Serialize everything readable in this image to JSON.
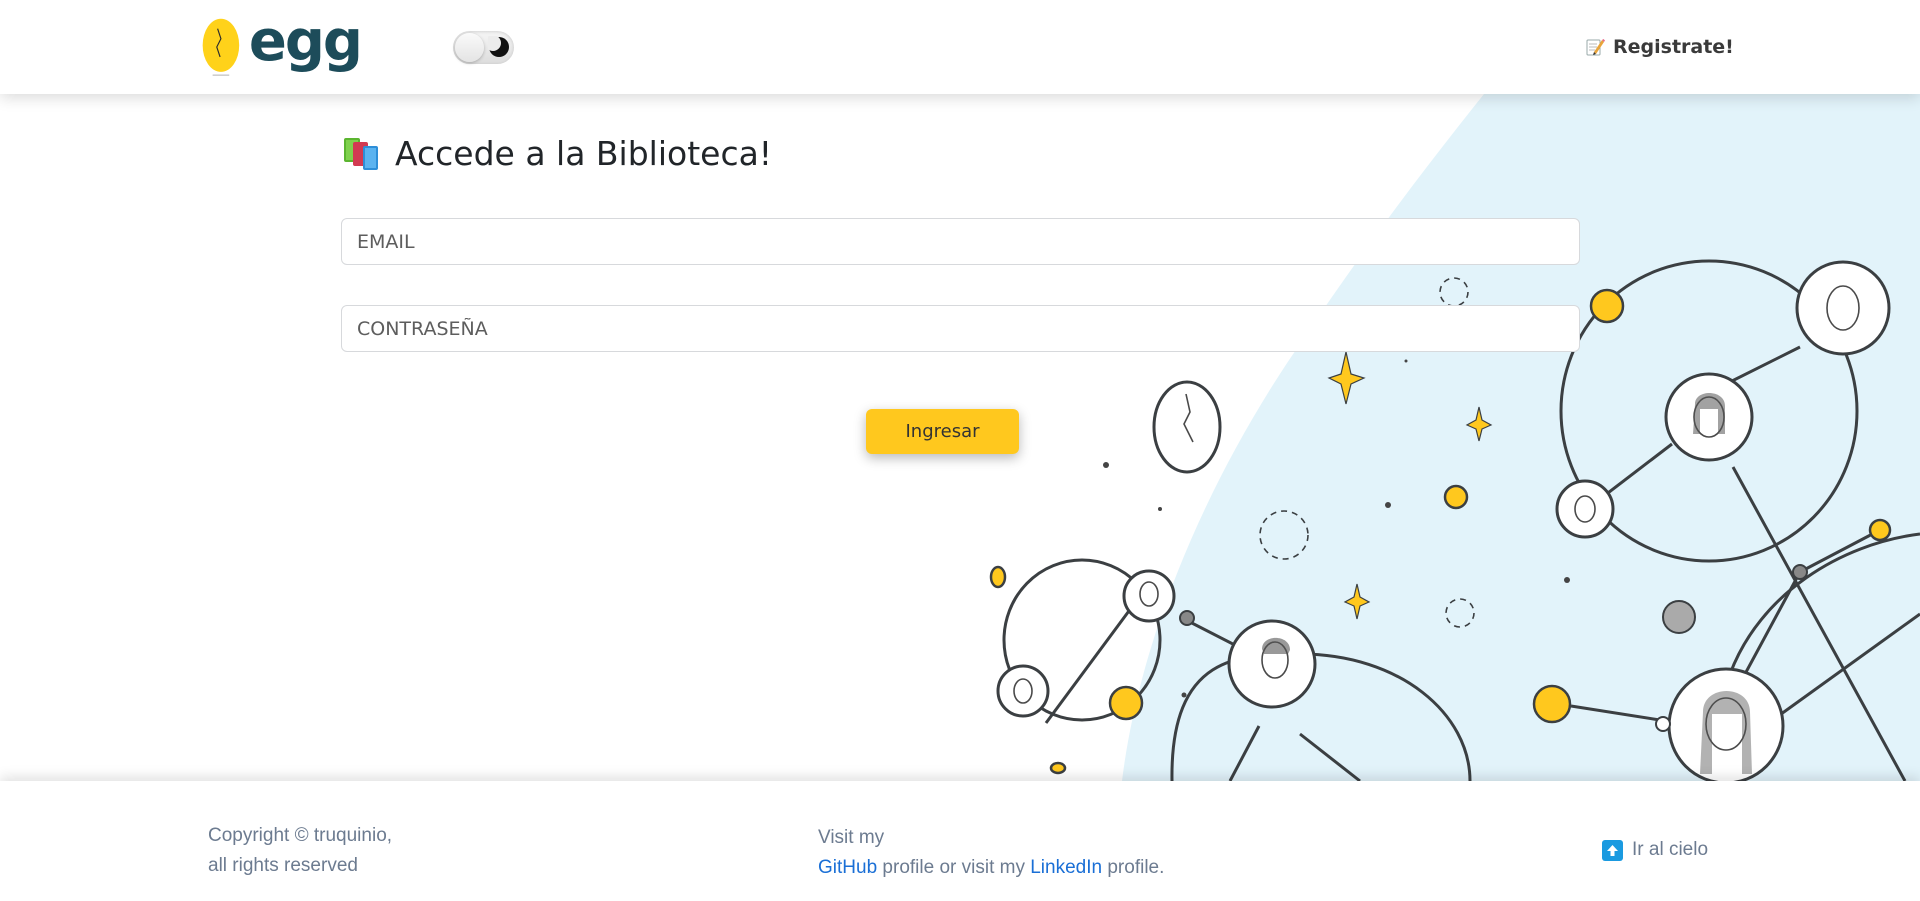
{
  "header": {
    "logo_text": "egg",
    "register_label": "Registrate!",
    "theme_toggle_state": "light"
  },
  "main": {
    "title": "Accede a la Biblioteca!",
    "email_placeholder": "EMAIL",
    "password_placeholder": "CONTRASEÑA",
    "submit_label": "Ingresar"
  },
  "footer": {
    "copyright_line1": "Copyright © truquinio,",
    "copyright_line2": "all rights reserved",
    "visit_prefix": "Visit my",
    "github_label": "GitHub",
    "visit_middle": "profile or visit my",
    "linkedin_label": "LinkedIn",
    "visit_suffix": "profile.",
    "scroll_top_label": "Ir al cielo"
  },
  "colors": {
    "accent_yellow": "#ffc81e",
    "logo_teal": "#1d4c5a",
    "link_blue": "#1a6fd6",
    "illustration_bg": "#e2f3fa"
  }
}
